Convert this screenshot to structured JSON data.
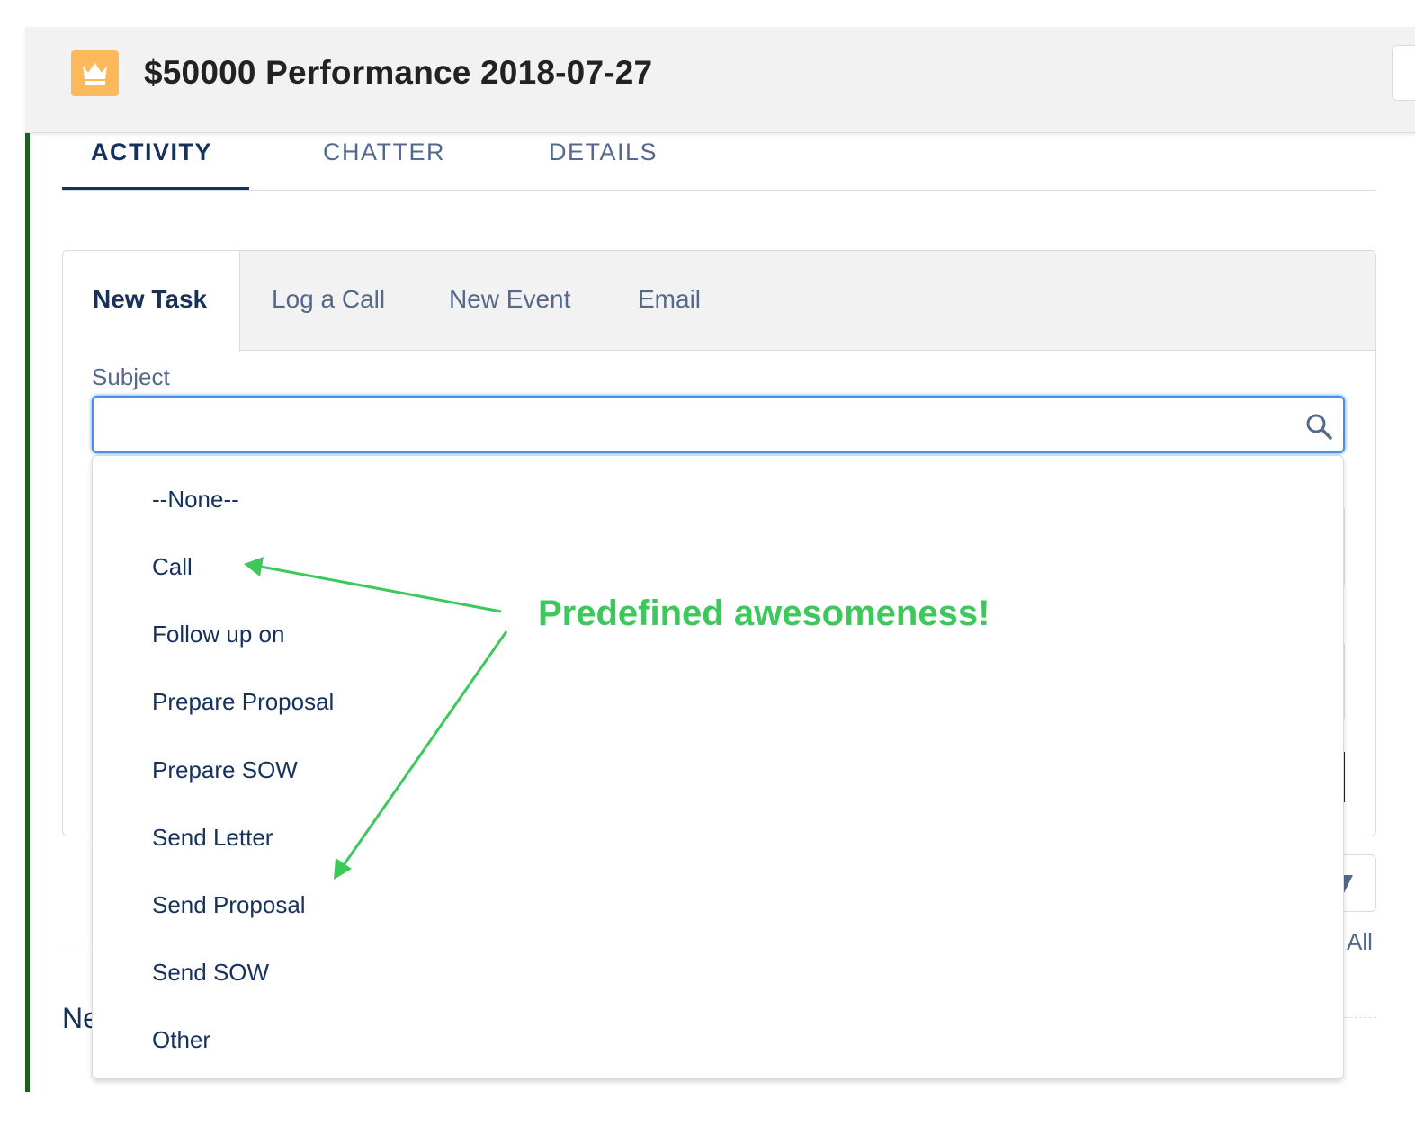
{
  "header": {
    "title": "$50000 Performance 2018-07-27",
    "icon": "crown-icon",
    "icon_color": "#fcb95b"
  },
  "main_tabs": [
    {
      "label": "ACTIVITY",
      "active": true
    },
    {
      "label": "CHATTER",
      "active": false
    },
    {
      "label": "DETAILS",
      "active": false
    }
  ],
  "composer": {
    "tabs": [
      {
        "label": "New Task",
        "active": true
      },
      {
        "label": "Log a Call",
        "active": false
      },
      {
        "label": "New Event",
        "active": false
      },
      {
        "label": "Email",
        "active": false
      }
    ],
    "subject": {
      "label": "Subject",
      "value": "",
      "focus_color": "#4a90e2"
    }
  },
  "dropdown": {
    "options": [
      "--None--",
      "Call",
      "Follow up on",
      "Prepare Proposal",
      "Prepare SOW",
      "Send Letter",
      "Send Proposal",
      "Send SOW",
      "Other"
    ]
  },
  "background": {
    "all_text": "All",
    "partial_heading": "Ne"
  },
  "annotation": {
    "text": "Predefined awesomeness!",
    "color": "#3cc85a"
  },
  "colors": {
    "accent_bar": "#1e5f1e",
    "text_primary": "#16325c",
    "text_secondary": "#54698d"
  }
}
